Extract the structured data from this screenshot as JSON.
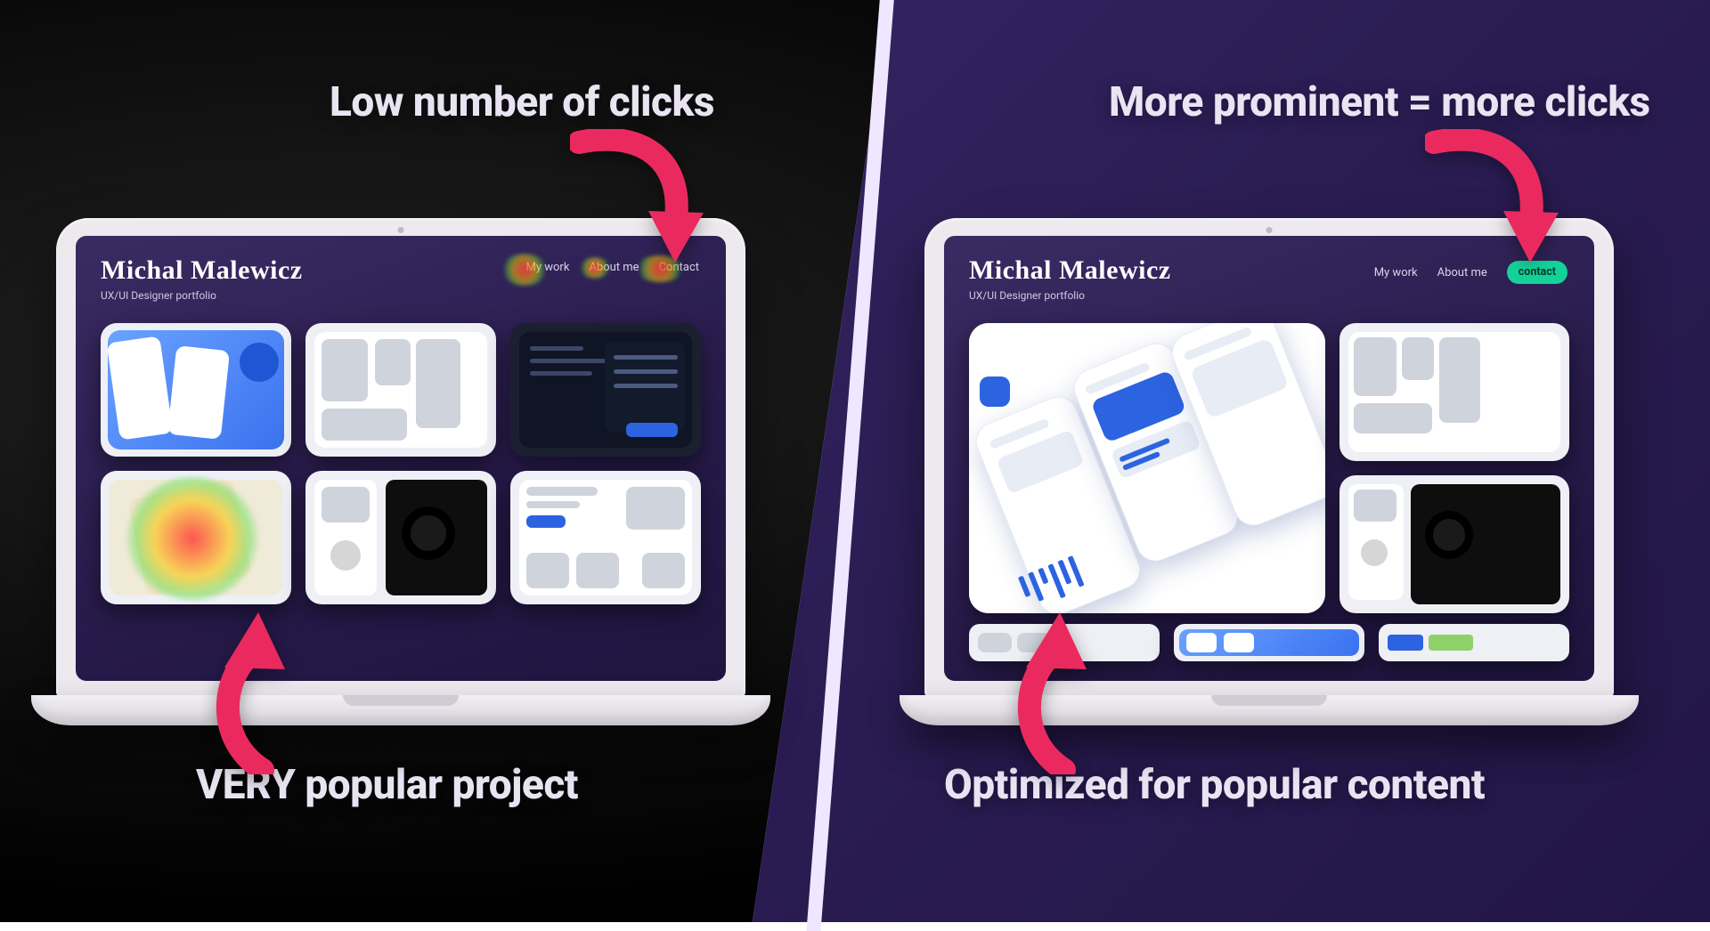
{
  "annotations": {
    "left_top": "Low number of clicks",
    "right_top": "More prominent = more clicks",
    "left_bottom": "VERY popular project",
    "right_bottom": "Optimized for popular content"
  },
  "portfolio": {
    "name": "Michal Malewicz",
    "tagline": "UX/UI Designer portfolio",
    "nav": {
      "work": "My work",
      "about": "About me",
      "contact_plain": "Contact",
      "contact_cta": "contact"
    }
  },
  "colors": {
    "arrow": "#ea2a5f",
    "cta": "#14d29a"
  }
}
